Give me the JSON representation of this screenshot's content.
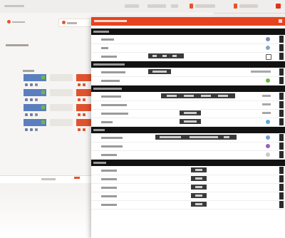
{
  "colors": {
    "accent": "#e8532b",
    "panel_header": "#e5421f",
    "section_bar": "#121212",
    "tile_blue": "#5b7fbe",
    "tile_red": "#e0532e",
    "ok_green": "#6bb84c"
  },
  "app": {
    "title": "",
    "tabs": [
      {
        "label": "",
        "icon": "home-icon"
      },
      {
        "label": "",
        "icon": "room-icon"
      }
    ],
    "toolbar": {
      "items": [
        {
          "label": "",
          "icon": "user-icon"
        },
        {
          "label": "",
          "icon": "group-icon"
        },
        {
          "label": "",
          "icon": "notification-icon"
        },
        {
          "label": "",
          "icon": "settings-icon"
        }
      ]
    },
    "sidebar_label": "",
    "grid_label": ""
  },
  "panel": {
    "title": "",
    "sections": [
      {
        "title": "",
        "rows": [
          {
            "label": "",
            "icon": "lamp-icon"
          },
          {
            "label": "",
            "icon": "globe-icon"
          },
          {
            "label": "",
            "icon": "monitor-icon"
          }
        ]
      },
      {
        "title": "",
        "rows": [
          {
            "label": "",
            "value": ""
          },
          {
            "label": "",
            "icon": "leaf-icon"
          }
        ]
      },
      {
        "title": "",
        "rows": [
          {
            "label": "",
            "value": ""
          },
          {
            "label": "",
            "value": ""
          },
          {
            "label": "",
            "value": ""
          },
          {
            "label": "",
            "value": ""
          }
        ]
      },
      {
        "title": "",
        "rows": [
          {
            "label": "",
            "icon": "user-icon"
          },
          {
            "label": "",
            "icon": "person-icon"
          },
          {
            "label": "",
            "icon": "reset-icon"
          }
        ]
      },
      {
        "title": "",
        "rows": [
          {
            "label": ""
          },
          {
            "label": ""
          },
          {
            "label": ""
          },
          {
            "label": ""
          },
          {
            "label": ""
          }
        ]
      }
    ]
  }
}
